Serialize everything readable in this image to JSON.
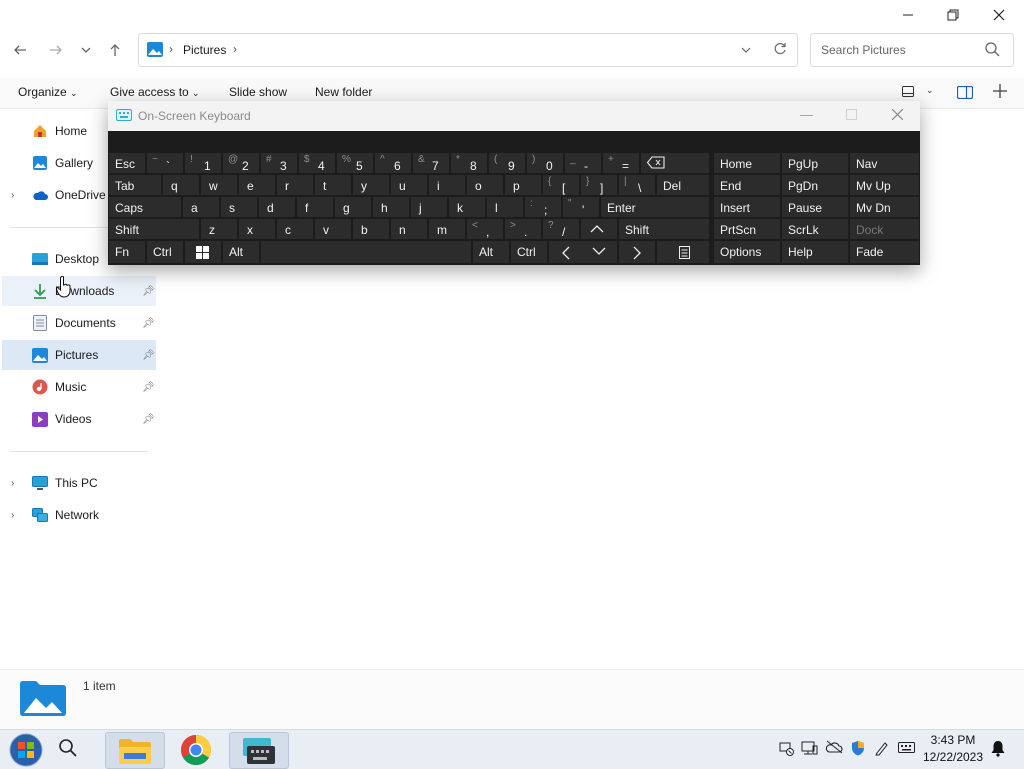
{
  "explorer": {
    "address": {
      "location": "Pictures"
    },
    "search": {
      "placeholder": "Search Pictures"
    },
    "toolbar": {
      "organize": "Organize",
      "give_access": "Give access to",
      "slide_show": "Slide show",
      "new_folder": "New folder"
    },
    "sidebar": {
      "home": "Home",
      "gallery": "Gallery",
      "onedrive": "OneDrive",
      "desktop": "Desktop",
      "downloads": "Downloads",
      "documents": "Documents",
      "pictures": "Pictures",
      "music": "Music",
      "videos": "Videos",
      "this_pc": "This PC",
      "network": "Network"
    },
    "status": {
      "item_count": "1 item"
    }
  },
  "osk": {
    "title": "On-Screen Keyboard",
    "keys": {
      "esc": "Esc",
      "tab": "Tab",
      "caps": "Caps",
      "lshift": "Shift",
      "fn": "Fn",
      "lctrl": "Ctrl",
      "lalt": "Alt",
      "ralt": "Alt",
      "rctrl": "Ctrl",
      "del": "Del",
      "enter": "Enter",
      "rshift": "Shift",
      "q": "q",
      "w": "w",
      "e": "e",
      "r": "r",
      "t": "t",
      "y": "y",
      "u": "u",
      "i": "i",
      "o": "o",
      "p": "p",
      "a": "a",
      "s": "s",
      "d": "d",
      "f": "f",
      "g": "g",
      "h": "h",
      "j": "j",
      "k": "k",
      "l": "l",
      "z": "z",
      "x": "x",
      "c": "c",
      "v": "v",
      "b": "b",
      "n": "n",
      "m": "m",
      "n1": "1",
      "n2": "2",
      "n3": "3",
      "n4": "4",
      "n5": "5",
      "n6": "6",
      "n7": "7",
      "n8": "8",
      "n9": "9",
      "n0": "0",
      "s1": "!",
      "s2": "@",
      "s3": "#",
      "s4": "$",
      "s5": "%",
      "s6": "^",
      "s7": "&",
      "s8": "*",
      "s9": "(",
      "s0": ")",
      "tilde_sh": "~",
      "tilde_mn": "`",
      "minus_sh": "_",
      "minus_mn": "-",
      "plus_sh": "+",
      "plus_mn": "=",
      "lbrace_sh": "{",
      "lbrace_mn": "[",
      "rbrace_sh": "}",
      "rbrace_mn": "]",
      "pipe_sh": "|",
      "pipe_mn": "\\",
      "colon_sh": ":",
      "colon_mn": ";",
      "quote_sh": "\"",
      "quote_mn": "'",
      "lt_sh": "<",
      "lt_mn": ",",
      "gt_sh": ">",
      "gt_mn": ".",
      "q_sh": "?",
      "q_mn": "/"
    },
    "nav": {
      "home": "Home",
      "pgup": "PgUp",
      "nav": "Nav",
      "end": "End",
      "pgdn": "PgDn",
      "mvup": "Mv Up",
      "insert": "Insert",
      "pause": "Pause",
      "mvdn": "Mv Dn",
      "prtscn": "PrtScn",
      "scrlk": "ScrLk",
      "dock": "Dock",
      "options": "Options",
      "help": "Help",
      "fade": "Fade"
    }
  },
  "taskbar": {
    "time": "3:43 PM",
    "date": "12/22/2023"
  },
  "colors": {
    "accent": "#0067c0",
    "osk_bg": "#1c1c1c",
    "osk_key": "#2c2c2c",
    "selected": "#dce8f5"
  }
}
